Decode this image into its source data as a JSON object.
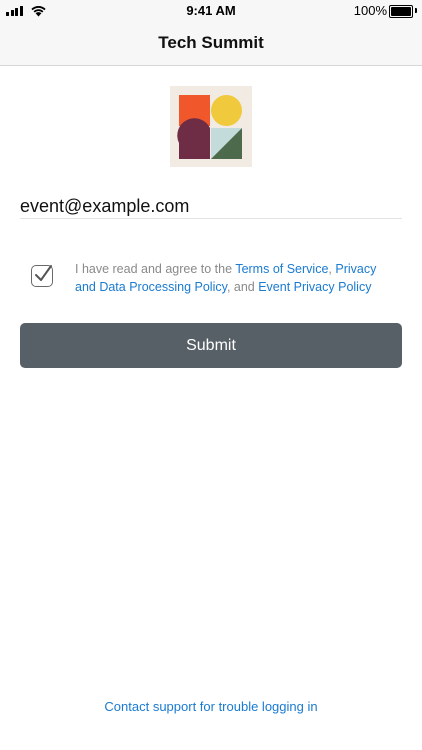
{
  "status_bar": {
    "time": "9:41 AM",
    "battery": "100%",
    "icons": [
      "cellular-signal-icon",
      "wifi-icon",
      "battery-icon"
    ],
    "battery_level": 1.0
  },
  "nav": {
    "title": "Tech Summit"
  },
  "logo": {
    "icon": "event-logo-icon",
    "colors": {
      "background": "#f1ebe3",
      "orange": "#f0572a",
      "yellow": "#f0c93c",
      "maroon": "#6e2c45",
      "light_blue": "#c4dbdc",
      "green": "#4e6a4c"
    }
  },
  "email": {
    "value": "event@example.com"
  },
  "agreement": {
    "checked": true,
    "prefix": "I have read and agree to the ",
    "terms_link": "Terms of Service",
    "sep1": ", ",
    "privacy_link": "Privacy and Data Processing Policy",
    "sep2": ", and ",
    "event_privacy_link": "Event Privacy Policy"
  },
  "submit": {
    "label": "Submit",
    "color": "#576066"
  },
  "footer": {
    "support_link": "Contact support for trouble logging in"
  },
  "colors": {
    "link": "#1a7bd1",
    "bar_background": "#f7f7f7"
  }
}
